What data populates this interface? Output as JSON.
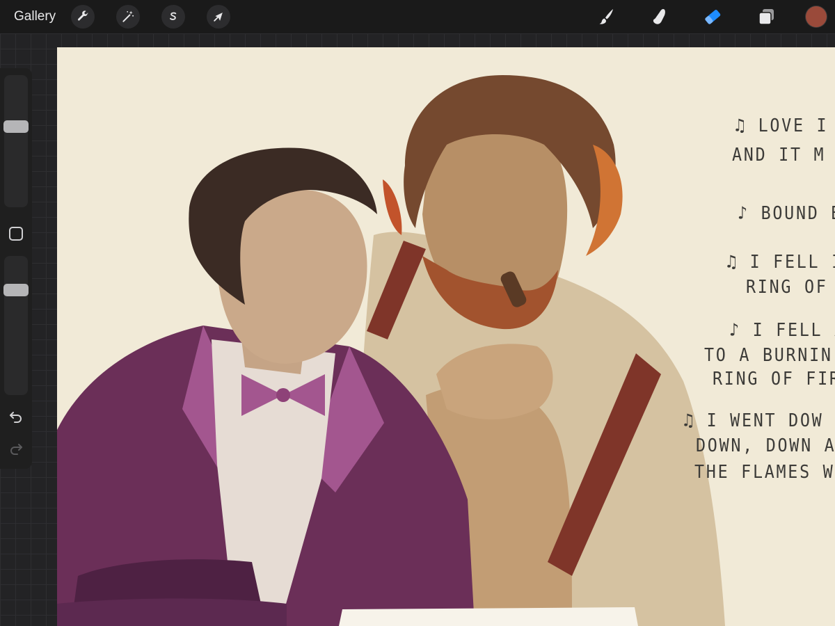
{
  "toolbar": {
    "gallery_label": "Gallery",
    "left_tools": [
      {
        "name": "actions",
        "icon": "wrench-icon"
      },
      {
        "name": "adjustments",
        "icon": "magic-wand-icon"
      },
      {
        "name": "selection",
        "icon": "selection-s-icon"
      },
      {
        "name": "transform",
        "icon": "arrow-cursor-icon"
      }
    ],
    "right_tools": [
      {
        "name": "brush",
        "icon": "brush-icon",
        "active": false
      },
      {
        "name": "smudge",
        "icon": "smudge-finger-icon",
        "active": false
      },
      {
        "name": "eraser",
        "icon": "eraser-icon",
        "active": true
      },
      {
        "name": "layers",
        "icon": "layers-icon",
        "active": false
      }
    ],
    "current_color": "#9a4a3a",
    "active_color": "#1e8cff"
  },
  "sidebar": {
    "brush_size_level": 0.62,
    "opacity_level": 0.78,
    "buttons": [
      "modify-icon",
      "undo-icon",
      "redo-icon"
    ]
  },
  "canvas": {
    "paper_color": "#f1ead7",
    "lyrics": [
      "♫ LOVE I",
      "AND IT M",
      "♪ BOUND B",
      "♫ I FELL I",
      "RING OF",
      "♪ I FELL A",
      "TO A BURNIN",
      "RING OF FIR",
      "♫ I WENT DOW",
      "DOWN, DOWN A",
      "THE FLAMES W"
    ],
    "colors": {
      "purple": "#6b2f58",
      "magenta": "#a3568f",
      "skin_left": "#c8a888",
      "skin_right": "#b88d64",
      "hair_dark": "#3d2d26",
      "hair_brown": "#7a4f32",
      "hair_flame": "#c8642e",
      "suspender": "#8a3b2e",
      "shirt": "#d9caa9"
    }
  }
}
